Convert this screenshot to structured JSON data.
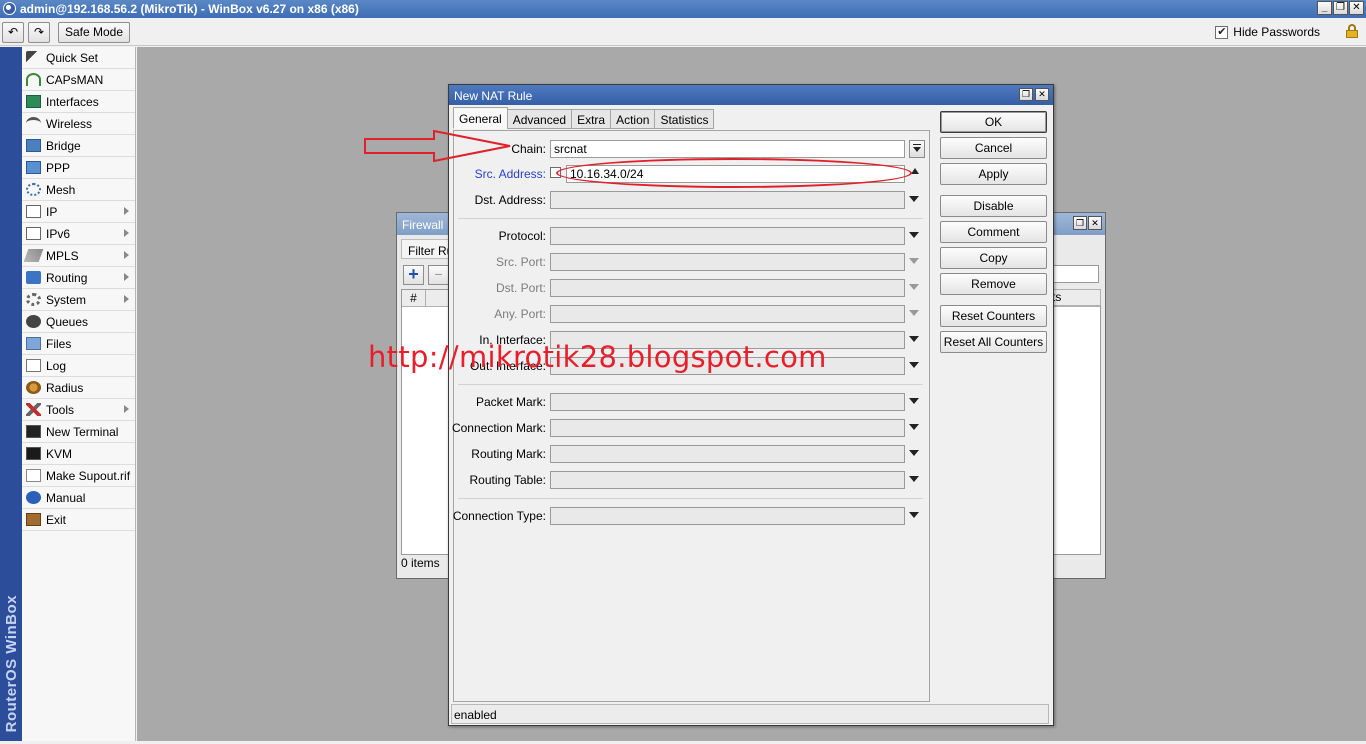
{
  "window": {
    "title": "admin@192.168.56.2 (MikroTik) - WinBox v6.27 on x86 (x86)",
    "minimize": "_",
    "maximize": "❐",
    "close": "✕"
  },
  "toolbar": {
    "undo": "↶",
    "redo": "↷",
    "safe_mode": "Safe Mode",
    "hide_passwords": "Hide Passwords",
    "hide_passwords_checked": true
  },
  "brand_strip": "RouterOS WinBox",
  "sidebar": {
    "items": [
      {
        "label": "Quick Set",
        "icon": "wand-icon"
      },
      {
        "label": "CAPsMAN",
        "icon": "antenna-icon"
      },
      {
        "label": "Interfaces",
        "icon": "ethernet-icon"
      },
      {
        "label": "Wireless",
        "icon": "wifi-icon"
      },
      {
        "label": "Bridge",
        "icon": "bridge-icon"
      },
      {
        "label": "PPP",
        "icon": "ppp-icon"
      },
      {
        "label": "Mesh",
        "icon": "mesh-icon"
      },
      {
        "label": "IP",
        "icon": "ip-icon",
        "submenu": true
      },
      {
        "label": "IPv6",
        "icon": "ipv6-icon",
        "submenu": true
      },
      {
        "label": "MPLS",
        "icon": "mpls-icon",
        "submenu": true
      },
      {
        "label": "Routing",
        "icon": "routing-icon",
        "submenu": true
      },
      {
        "label": "System",
        "icon": "gear-icon",
        "submenu": true
      },
      {
        "label": "Queues",
        "icon": "queues-icon"
      },
      {
        "label": "Files",
        "icon": "folder-icon"
      },
      {
        "label": "Log",
        "icon": "log-icon"
      },
      {
        "label": "Radius",
        "icon": "users-icon"
      },
      {
        "label": "Tools",
        "icon": "tools-icon",
        "submenu": true
      },
      {
        "label": "New Terminal",
        "icon": "terminal-icon"
      },
      {
        "label": "KVM",
        "icon": "monitor-icon"
      },
      {
        "label": "Make Supout.rif",
        "icon": "document-icon"
      },
      {
        "label": "Manual",
        "icon": "help-icon"
      },
      {
        "label": "Exit",
        "icon": "exit-icon"
      }
    ]
  },
  "firewall": {
    "title": "Firewall",
    "tab": "Filter Rul",
    "add": "+",
    "remove": "−",
    "col_hash": "#",
    "col_right": "ts",
    "status": "0 items"
  },
  "nat": {
    "title": "New NAT Rule",
    "tabs": [
      "General",
      "Advanced",
      "Extra",
      "Action",
      "Statistics"
    ],
    "fields": {
      "chain_label": "Chain:",
      "chain_value": "srcnat",
      "src_label": "Src. Address:",
      "src_value": "10.16.34.0/24",
      "dst_label": "Dst. Address:",
      "protocol_label": "Protocol:",
      "src_port_label": "Src. Port:",
      "dst_port_label": "Dst. Port:",
      "any_port_label": "Any. Port:",
      "in_iface_label": "In. Interface:",
      "out_iface_label": "Out. Interface:",
      "packet_mark_label": "Packet Mark:",
      "conn_mark_label": "Connection Mark:",
      "routing_mark_label": "Routing Mark:",
      "routing_table_label": "Routing Table:",
      "conn_type_label": "Connection Type:"
    },
    "buttons": {
      "ok": "OK",
      "cancel": "Cancel",
      "apply": "Apply",
      "disable": "Disable",
      "comment": "Comment",
      "copy": "Copy",
      "remove": "Remove",
      "reset_counters": "Reset Counters",
      "reset_all_counters": "Reset All Counters"
    },
    "status": "enabled"
  },
  "watermark": "http://mikrotik28.blogspot.com",
  "colors": {
    "accent_blue": "#2c4d9a",
    "annotation_red": "#e0202a",
    "workspace_gray": "#a9a9a9"
  }
}
